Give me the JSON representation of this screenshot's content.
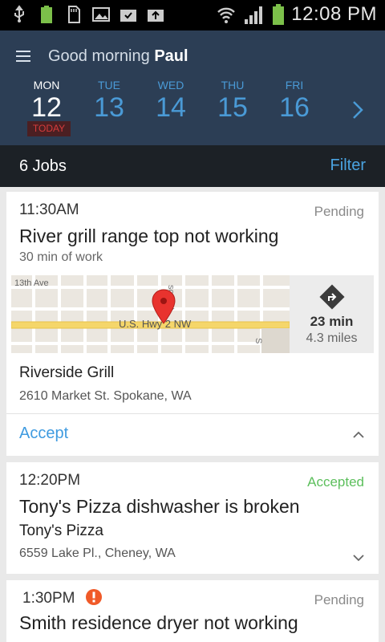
{
  "status_bar": {
    "time": "12:08 PM",
    "battery_level": "100%",
    "icons": [
      "usb-icon",
      "battery-full-icon",
      "sd-card-icon",
      "image-icon",
      "download-icon",
      "upload-icon",
      "wifi-icon",
      "signal-icon"
    ]
  },
  "header": {
    "greeting": "Good morning",
    "user": "Paul",
    "today_label": "TODAY",
    "days": [
      {
        "dow": "MON",
        "num": "12",
        "active": true
      },
      {
        "dow": "TUE",
        "num": "13",
        "active": false
      },
      {
        "dow": "WED",
        "num": "14",
        "active": false
      },
      {
        "dow": "THU",
        "num": "15",
        "active": false
      },
      {
        "dow": "FRI",
        "num": "16",
        "active": false
      }
    ]
  },
  "jobs_bar": {
    "count_label": "6 Jobs",
    "filter_label": "Filter"
  },
  "jobs": [
    {
      "time": "11:30AM",
      "status": "Pending",
      "title": "River grill range top not working",
      "duration": "30 min of work",
      "map": {
        "street_1": "13th Ave",
        "street_2": "U.S. Hwy 2 NW",
        "street_3": "son St",
        "street_4": "S"
      },
      "directions": {
        "minutes": "23 min",
        "miles": "4.3 miles"
      },
      "business": "Riverside Grill",
      "address": "2610 Market St. Spokane, WA",
      "action": "Accept"
    },
    {
      "time": "12:20PM",
      "status": "Accepted",
      "title": "Tony's Pizza dishwasher is broken",
      "business": "Tony's Pizza",
      "address": "6559 Lake Pl., Cheney, WA"
    },
    {
      "time": "1:30PM",
      "status": "Pending",
      "title": "Smith residence dryer not working"
    }
  ],
  "colors": {
    "header_bg": "#2c3e55",
    "accent_blue": "#4a9ad6",
    "accepted_green": "#5cbf5c",
    "alert_orange": "#f05a28",
    "pin_red": "#e8332e"
  }
}
